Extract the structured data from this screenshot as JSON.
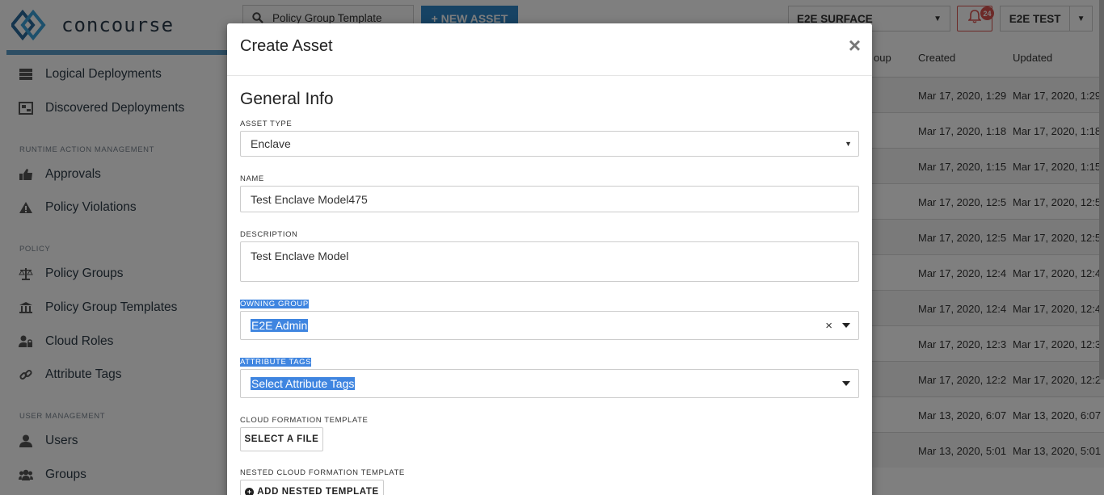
{
  "app": {
    "logo_text": "concourse",
    "search_value": "Policy Group Template",
    "new_asset_label": "+ NEW ASSET",
    "environment": "E2E SURFACE",
    "notification_count": "24",
    "user_label": "E2E TEST"
  },
  "sidebar": {
    "items_top": [
      {
        "label": "Logical Deployments",
        "icon": "server-stack-icon"
      },
      {
        "label": "Discovered Deployments",
        "icon": "discovery-icon"
      }
    ],
    "section_runtime": "RUNTIME ACTION MANAGEMENT",
    "items_runtime": [
      {
        "label": "Approvals",
        "icon": "thumbs-up-icon"
      },
      {
        "label": "Policy Violations",
        "icon": "warning-icon"
      }
    ],
    "section_policy": "POLICY",
    "items_policy": [
      {
        "label": "Policy Groups",
        "icon": "balance-scale-icon"
      },
      {
        "label": "Policy Group Templates",
        "icon": "institution-icon"
      },
      {
        "label": "Cloud Roles",
        "icon": "user-lock-icon"
      },
      {
        "label": "Attribute Tags",
        "icon": "link-icon"
      }
    ],
    "section_user": "USER MANAGEMENT",
    "items_user": [
      {
        "label": "Users",
        "icon": "user-icon"
      },
      {
        "label": "Groups",
        "icon": "users-icon"
      }
    ]
  },
  "table": {
    "headers": [
      "oup",
      "Created",
      "Updated"
    ],
    "rows": [
      {
        "created": "Mar 17, 2020, 1:29",
        "updated": "Mar 17, 2020, 1:29"
      },
      {
        "created": "Mar 17, 2020, 1:18",
        "updated": "Mar 17, 2020, 1:18"
      },
      {
        "created": "Mar 17, 2020, 1:15",
        "updated": "Mar 17, 2020, 1:15"
      },
      {
        "created": "Mar 17, 2020, 12:5",
        "updated": "Mar 17, 2020, 12:5"
      },
      {
        "created": "Mar 17, 2020, 12:5",
        "updated": "Mar 17, 2020, 12:5"
      },
      {
        "created": "Mar 17, 2020, 12:4",
        "updated": "Mar 17, 2020, 12:4"
      },
      {
        "created": "Mar 17, 2020, 12:4",
        "updated": "Mar 17, 2020, 12:4"
      },
      {
        "created": "Mar 17, 2020, 12:3",
        "updated": "Mar 17, 2020, 12:3"
      },
      {
        "created": "Mar 17, 2020, 12:2",
        "updated": "Mar 17, 2020, 12:2"
      },
      {
        "created": "Mar 13, 2020, 6:07",
        "updated": "Mar 13, 2020, 6:07"
      },
      {
        "created": "Mar 13, 2020, 5:01",
        "updated": "Mar 13, 2020, 5:01"
      }
    ]
  },
  "modal": {
    "title": "Create Asset",
    "close": "×",
    "section_title": "General Info",
    "asset_type_label": "ASSET TYPE",
    "asset_type_value": "Enclave",
    "name_label": "NAME",
    "name_value": "Test Enclave Model475",
    "description_label": "DESCRIPTION",
    "description_value": "Test Enclave Model",
    "owning_group_label": "OWNING GROUP",
    "owning_group_value": "E2E Admin",
    "attribute_tags_label": "ATTRIBUTE TAGS",
    "attribute_tags_placeholder": "Select Attribute Tags",
    "cft_label": "CLOUD FORMATION TEMPLATE",
    "select_file_label": "SELECT A FILE",
    "nested_cft_label": "NESTED CLOUD FORMATION TEMPLATE",
    "add_nested_label": "ADD NESTED TEMPLATE"
  },
  "colors": {
    "accent": "#2f86c8",
    "selection": "#3f85e0",
    "alert": "#d9534f"
  }
}
